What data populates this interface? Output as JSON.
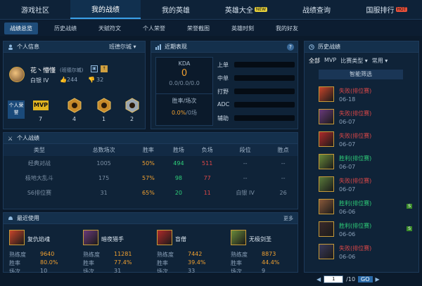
{
  "top_nav": [
    {
      "label": "游戏社区"
    },
    {
      "label": "我的战绩",
      "active": true
    },
    {
      "label": "我的英雄"
    },
    {
      "label": "英雄大全",
      "badge": "NEW",
      "badge_color": "#e7d13a"
    },
    {
      "label": "战绩查询"
    },
    {
      "label": "国服排行",
      "badge": "HOT",
      "badge_color": "#e8503a"
    }
  ],
  "sub_nav": [
    {
      "label": "战绩总览",
      "active": true
    },
    {
      "label": "历史战绩"
    },
    {
      "label": "天赋符文"
    },
    {
      "label": "个人荣誉"
    },
    {
      "label": "荣誉截图"
    },
    {
      "label": "英雄时刻"
    },
    {
      "label": "我的好友"
    }
  ],
  "personal_info": {
    "title": "个人信息",
    "server": "班德尔城",
    "name": "花丶懵懂",
    "server_tag": "(班德尔城)",
    "rank": "白银 IV",
    "likes": "244",
    "dislikes": "32",
    "honor_label": "个人荣誉",
    "honors": [
      {
        "icon": "mvp-icon",
        "text": "MVP",
        "count": "7"
      },
      {
        "icon": "triple-kill-icon",
        "text": "",
        "count": "4"
      },
      {
        "icon": "quadra-kill-icon",
        "text": "",
        "count": "1"
      },
      {
        "icon": "penta-kill-icon",
        "text": "",
        "count": "2"
      }
    ]
  },
  "recent": {
    "title": "近期表现",
    "kda_label": "KDA",
    "kda_value": "0",
    "kda_detail": "0.0/0.0/0.0",
    "winrate_label": "胜率/场次",
    "winrate_value": "0.0%",
    "winrate_games": "/0场",
    "lanes": [
      {
        "name": "上单"
      },
      {
        "name": "中单"
      },
      {
        "name": "打野"
      },
      {
        "name": "ADC"
      },
      {
        "name": "辅助"
      }
    ]
  },
  "stats": {
    "title": "个人战绩",
    "headers": [
      "类型",
      "总数场次",
      "胜率",
      "胜场",
      "负场",
      "段位",
      "胜点"
    ],
    "rows": [
      [
        "经典对战",
        "1005",
        "50%",
        "494",
        "511",
        "--",
        "--"
      ],
      [
        "极地大乱斗",
        "175",
        "57%",
        "98",
        "77",
        "--",
        "--"
      ],
      [
        "S6排位赛",
        "31",
        "65%",
        "20",
        "11",
        "白银 IV",
        "26"
      ]
    ]
  },
  "recent_used": {
    "title": "最近使用",
    "more": "更多",
    "labels": {
      "proficiency": "熟练度",
      "winrate": "胜率",
      "games": "场次"
    },
    "heroes": [
      {
        "name": "复仇焰魂",
        "proficiency": "9640",
        "winrate": "80.0%",
        "games": "10",
        "color": "#c8452a"
      },
      {
        "name": "暗夜猎手",
        "proficiency": "11281",
        "winrate": "77.4%",
        "games": "31",
        "color": "#6a3a7a"
      },
      {
        "name": "盲僧",
        "proficiency": "7442",
        "winrate": "39.4%",
        "games": "33",
        "color": "#b02a2a"
      },
      {
        "name": "无极剑圣",
        "proficiency": "8873",
        "winrate": "44.4%",
        "games": "9",
        "color": "#6a8a3a"
      }
    ]
  },
  "history": {
    "title": "历史战绩",
    "filters": [
      {
        "label": "全部"
      },
      {
        "label": "MVP"
      },
      {
        "label": "比赛类型"
      },
      {
        "label": "常用"
      }
    ],
    "smart_filter": "智能筛选",
    "items": [
      {
        "result": "失败",
        "mode": "(排位赛)",
        "date": "06-18",
        "win": false,
        "color": "#c8452a",
        "tag": ""
      },
      {
        "result": "失败",
        "mode": "(排位赛)",
        "date": "06-07",
        "win": false,
        "color": "#6a3a7a",
        "tag": ""
      },
      {
        "result": "失败",
        "mode": "(排位赛)",
        "date": "06-07",
        "win": false,
        "color": "#b02a2a",
        "tag": ""
      },
      {
        "result": "胜利",
        "mode": "(排位赛)",
        "date": "06-07",
        "win": true,
        "color": "#6a8a3a",
        "tag": ""
      },
      {
        "result": "失败",
        "mode": "(排位赛)",
        "date": "06-07",
        "win": false,
        "color": "#5a7a3a",
        "tag": ""
      },
      {
        "result": "胜利",
        "mode": "(排位赛)",
        "date": "06-06",
        "win": true,
        "color": "#8a5a3a",
        "tag": "S"
      },
      {
        "result": "胜利",
        "mode": "(排位赛)",
        "date": "06-06",
        "win": true,
        "color": "#3a2a2a",
        "tag": "S"
      },
      {
        "result": "失败",
        "mode": "(排位赛)",
        "date": "06-06",
        "win": false,
        "color": "#3a3a5a",
        "tag": ""
      }
    ],
    "pager": {
      "current": "1",
      "total": "/10",
      "go": "GO"
    }
  }
}
